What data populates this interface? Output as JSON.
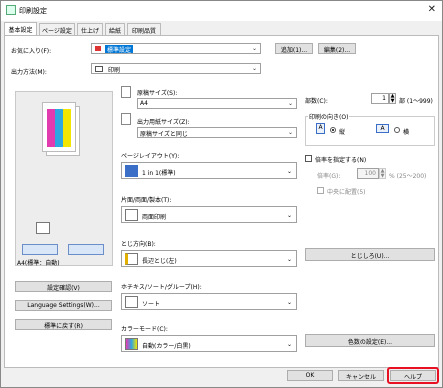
{
  "window": {
    "title": "印刷設定",
    "close_glyph": "✕"
  },
  "tabs": [
    {
      "label": "基本設定"
    },
    {
      "label": "ページ設定"
    },
    {
      "label": "仕上げ"
    },
    {
      "label": "給紙"
    },
    {
      "label": "印刷品質"
    }
  ],
  "favorites": {
    "label": "お気に入り(F):",
    "value": "標準設定",
    "add_button": "追加(1)...",
    "edit_button": "編集(2)..."
  },
  "output_method": {
    "label": "出力方法(M):",
    "value": "印刷"
  },
  "preview": {
    "caption": "A4(標準：自動)"
  },
  "left_buttons": {
    "confirm": "設定確認(V)",
    "language": "Language Settings(W)...",
    "restore": "標準に戻す(R)"
  },
  "original_size": {
    "label": "原稿サイズ(S):",
    "value": "A4"
  },
  "output_paper_size": {
    "label": "出力用紙サイズ(Z):",
    "value": "原稿サイズと同じ"
  },
  "page_layout": {
    "label": "ページレイアウト(Y):",
    "value": "1 in 1(標準)"
  },
  "duplex": {
    "label": "片面/両面/製本(T):",
    "value": "両面印刷"
  },
  "binding": {
    "label": "とじ方向(B):",
    "value": "長辺とじ(左)"
  },
  "finishing": {
    "label": "ホチキス/ソート/グループ(H):",
    "value": "ソート"
  },
  "color_mode": {
    "label": "カラーモード(C):",
    "value": "自動(カラー/白黒)"
  },
  "copies": {
    "label": "部数(C):",
    "value": "1",
    "unit": "部 (1～999)"
  },
  "orientation": {
    "label": "印刷の向き(O)",
    "portrait": "縦",
    "landscape": "横",
    "selected": "portrait"
  },
  "magnification": {
    "checkbox": "倍率を指定する(N)",
    "label": "倍率(G):",
    "value": "100",
    "unit": "% (25～200)",
    "center": "中央に配置(5)"
  },
  "margin_button": "とじしろ(U)...",
  "color_settings_button": "色数の設定(E)...",
  "footer": {
    "ok": "OK",
    "cancel": "キャンセル",
    "help": "ヘルプ"
  },
  "colors": {
    "accent": "#0078d7",
    "help_outline": "#e81123"
  }
}
